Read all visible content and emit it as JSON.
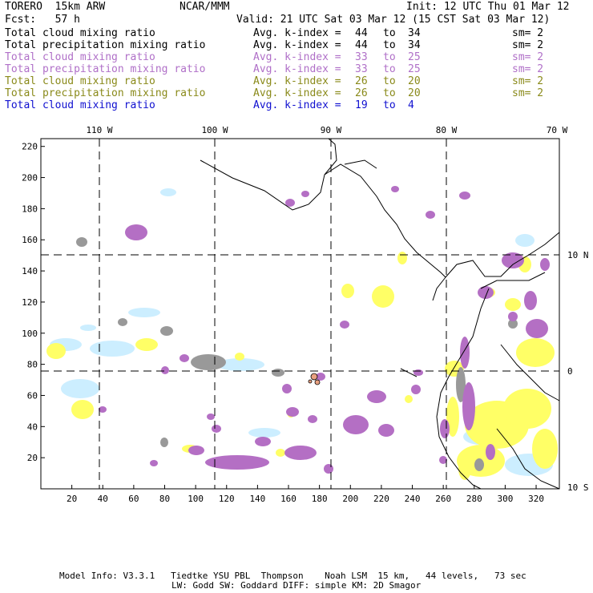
{
  "header": {
    "model": "TORERO  15km ARW",
    "org": "NCAR/MMM",
    "init": "Init: 12 UTC Thu 01 Mar 12",
    "fcst": "Fcst:   57 h",
    "valid": "Valid: 21 UTC Sat 03 Mar 12 (15 CST Sat 03 Mar 12)"
  },
  "legend": [
    {
      "field": "Total cloud mixing ratio",
      "index": "Avg. k-index =",
      "from": "44",
      "to_word": "to",
      "to": "34",
      "sm": "sm= 2",
      "color": "#000000"
    },
    {
      "field": "Total precipitation mixing ratio",
      "index": "Avg. k-index =",
      "from": "44",
      "to_word": "to",
      "to": "34",
      "sm": "sm= 2",
      "color": "#000000"
    },
    {
      "field": "Total cloud mixing ratio",
      "index": "Avg. k-index =",
      "from": "33",
      "to_word": "to",
      "to": "25",
      "sm": "sm= 2",
      "color": "#b070c8"
    },
    {
      "field": "Total precipitation mixing ratio",
      "index": "Avg. k-index =",
      "from": "33",
      "to_word": "to",
      "to": "25",
      "sm": "sm= 2",
      "color": "#b070c8"
    },
    {
      "field": "Total cloud mixing ratio",
      "index": "Avg. k-index =",
      "from": "26",
      "to_word": "to",
      "to": "20",
      "sm": "sm= 2",
      "color": "#8a8a1a"
    },
    {
      "field": "Total precipitation mixing ratio",
      "index": "Avg. k-index =",
      "from": "26",
      "to_word": "to",
      "to": "20",
      "sm": "sm= 2",
      "color": "#8a8a1a"
    },
    {
      "field": "Total cloud mixing ratio",
      "index": "Avg. k-index =",
      "from": "19",
      "to_word": "to",
      "to": "4",
      "sm": "",
      "color": "#1010d0"
    }
  ],
  "map": {
    "lon_labels": [
      "110 W",
      "100 W",
      "90 W",
      "80 W",
      "70 W"
    ],
    "lat_labels": [
      "10 N",
      "0",
      "10 S"
    ],
    "grid_y_ticks": [
      "220",
      "200",
      "180",
      "160",
      "140",
      "120",
      "100",
      "80",
      "60",
      "40",
      "20"
    ],
    "grid_x_ticks": [
      "20",
      "40",
      "60",
      "80",
      "100",
      "120",
      "140",
      "160",
      "180",
      "200",
      "220",
      "240",
      "260",
      "280",
      "300",
      "320"
    ],
    "x_range": [
      0,
      335
    ],
    "y_range": [
      0,
      225
    ],
    "colors": {
      "precip_magenta": "#b46fc4",
      "cloud_yellow": "#ffff66",
      "cloud_cyan": "#cceeff",
      "cloud_gray": "#999999",
      "coast": "#000000"
    }
  },
  "footer": {
    "line1": "Model Info: V3.3.1   Tiedtke YSU PBL  Thompson    Noah LSM  15 km,   44 levels,   73 sec",
    "line2": "LW: Godd SW: Goddard DIFF: simple KM: 2D Smagor"
  }
}
